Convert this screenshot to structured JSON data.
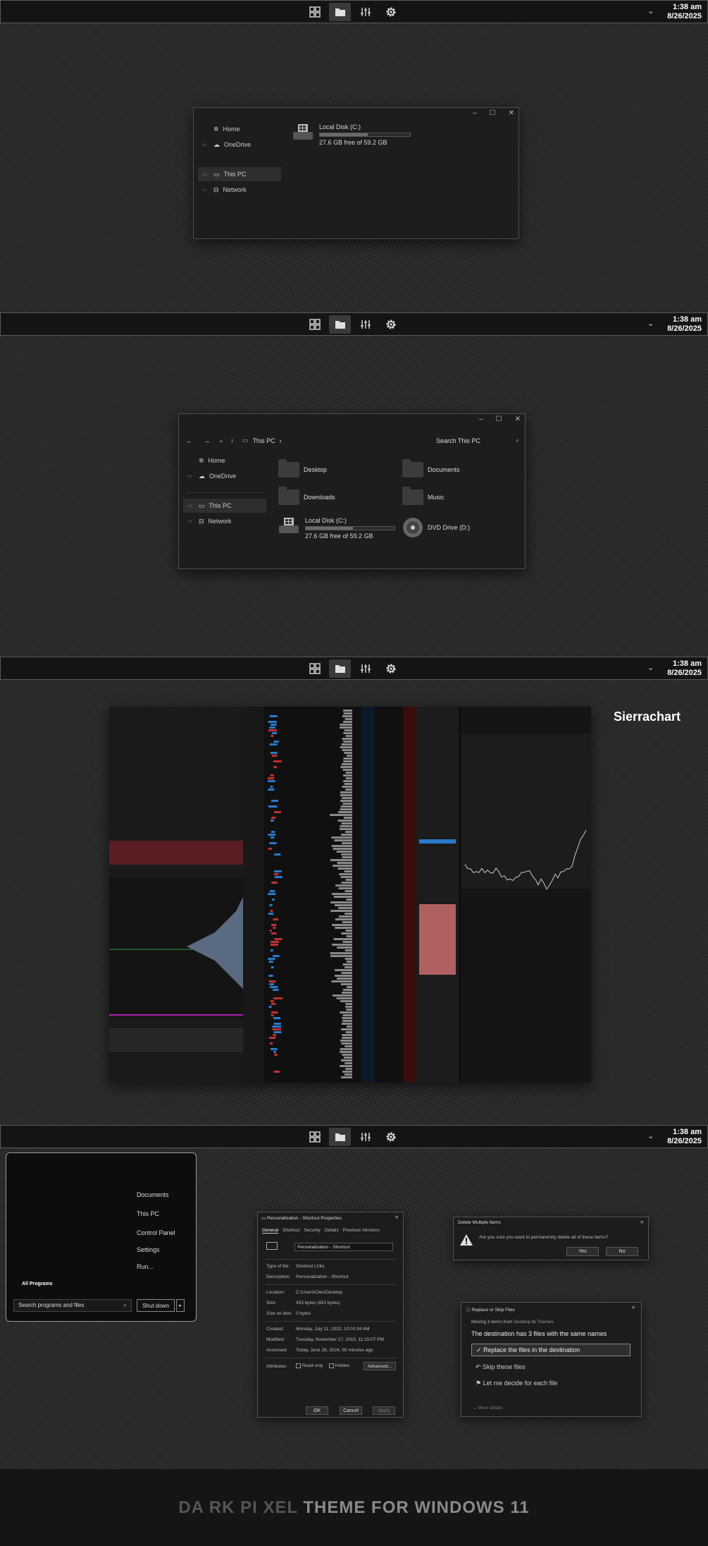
{
  "taskbar": {
    "buttons": [
      {
        "name": "start-grid-icon"
      },
      {
        "name": "folder-icon"
      },
      {
        "name": "sliders-icon"
      },
      {
        "name": "gear-icon"
      }
    ],
    "chevron": "⌄",
    "time": "1:38 am",
    "date": "8/26/2025"
  },
  "explorer1": {
    "controls": [
      "–",
      "☐",
      "✕"
    ],
    "nav": [
      {
        "label": "Home",
        "icon": "home-icon"
      },
      {
        "label": "OneDrive",
        "icon": "cloud-icon"
      },
      {
        "label": "This PC",
        "icon": "pc-icon"
      },
      {
        "label": "Network",
        "icon": "network-icon"
      }
    ],
    "drive": {
      "name": "Local Disk (C:)",
      "free": "27.6 GB free of 59.2 GB",
      "used_fraction": 0.53
    }
  },
  "explorer2": {
    "breadcrumb": "This PC",
    "breadcrumb_sep": "›",
    "search_placeholder": "Search This PC",
    "nav": [
      {
        "label": "Home"
      },
      {
        "label": "OneDrive"
      },
      {
        "label": "This PC"
      },
      {
        "label": "Network"
      }
    ],
    "folders": [
      "Desktop",
      "Documents",
      "Downloads",
      "Music"
    ],
    "drive": {
      "name": "Local Disk (C:)",
      "free": "27.6 GB free of 59.2 GB",
      "used_fraction": 0.53
    },
    "dvd": "DVD Drive (D:)"
  },
  "sierra_label": "Sierrachart",
  "start_menu": {
    "items": [
      "Documents",
      "This PC",
      "Control Panel",
      "Settings",
      "Run..."
    ],
    "all_programs": "All Programs",
    "search_placeholder": "Search programs and files",
    "shutdown": "Shut down",
    "shutdown_arrow": "▸"
  },
  "properties": {
    "title": "Personalization - Shortcut Properties",
    "tabs": [
      "General",
      "Shortcut",
      "Security",
      "Details",
      "Previous Versions"
    ],
    "name_value": "Personalization - Shortcut",
    "rows1": [
      {
        "k": "Type of file:",
        "v": "Shortcut (.lnk)"
      },
      {
        "k": "Description:",
        "v": "Personalization - Shortcut"
      }
    ],
    "rows2": [
      {
        "k": "Location:",
        "v": "C:\\Users\\Cleo\\Desktop"
      },
      {
        "k": "Size:",
        "v": "453 bytes (453 bytes)"
      },
      {
        "k": "Size on disk:",
        "v": "0 bytes"
      }
    ],
    "rows3": [
      {
        "k": "Created:",
        "v": "Monday, July 11, 2022, 10:03:34 AM"
      },
      {
        "k": "Modified:",
        "v": "Tuesday, November 17, 2015, 11:15:07 PM"
      },
      {
        "k": "Accessed:",
        "v": "Today, June 28, 2024, 55 minutes ago"
      }
    ],
    "attributes_label": "Attributes:",
    "readonly": "Read-only",
    "hidden": "Hidden",
    "advanced": "Advanced...",
    "ok": "OK",
    "cancel": "Cancel",
    "apply": "Apply"
  },
  "delete_dialog": {
    "title": "Delete Multiple Items",
    "message": "Are you sure you want to permanently delete all of these items?",
    "yes": "Yes",
    "no": "No"
  },
  "replace_dialog": {
    "title": "Replace or Skip Files",
    "moving_prefix": "Moving 3 items from",
    "from": "Desktop",
    "to_word": "to",
    "to": "Themes",
    "heading": "The destination has 3 files with the same names",
    "options": [
      "Replace the files in the destination",
      "Skip these files",
      "Let me decide for each file"
    ],
    "more": "More details"
  },
  "footer": {
    "title_parts": [
      "DA",
      "RK",
      "PI",
      "XEL"
    ],
    "title_rest": "THEME FOR WINDOWS 11"
  }
}
